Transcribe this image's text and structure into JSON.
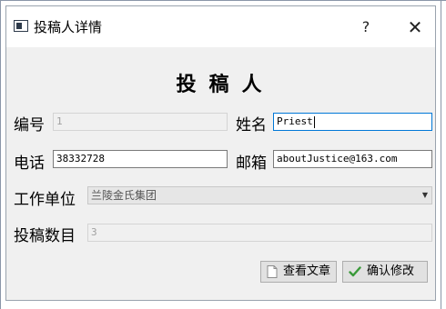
{
  "window": {
    "title": "投稿人详情",
    "help_label": "?",
    "close_label": "✕"
  },
  "heading": "投稿人",
  "form": {
    "id_label": "编号",
    "id_value": "1",
    "name_label": "姓名",
    "name_value": "Priest",
    "phone_label": "电话",
    "phone_value": "38332728",
    "email_label": "邮箱",
    "email_value": "aboutJustice@163.com",
    "workplace_label": "工作单位",
    "workplace_value": "兰陵金氏集团",
    "count_label": "投稿数目",
    "count_value": "3"
  },
  "buttons": {
    "view_articles": "查看文章",
    "confirm_edit": "确认修改"
  },
  "icons": {
    "app": "window-icon",
    "document": "document-icon",
    "check": "check-icon"
  },
  "colors": {
    "check": "#3a9a3a",
    "focus_border": "#0078d7"
  }
}
